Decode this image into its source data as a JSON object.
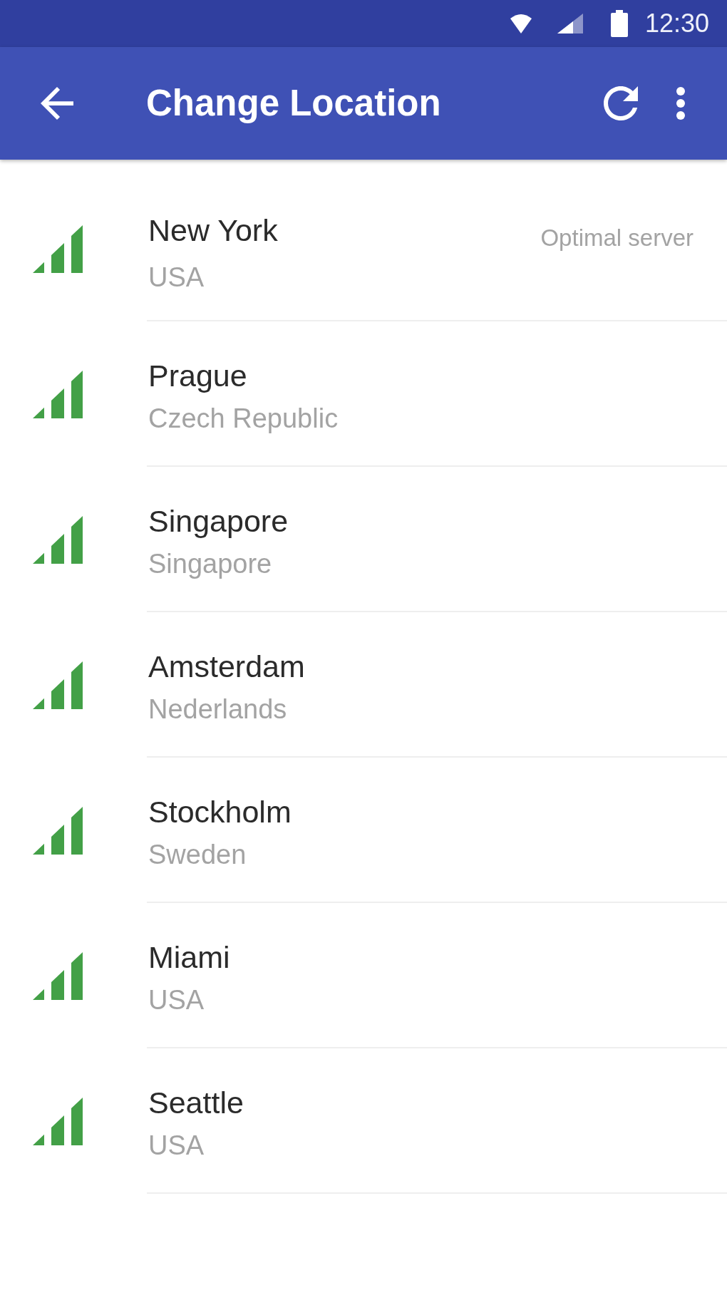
{
  "status_bar": {
    "time": "12:30"
  },
  "app_bar": {
    "title": "Change Location"
  },
  "locations": [
    {
      "city": "New York",
      "country": "USA",
      "note": "Optimal server"
    },
    {
      "city": "Prague",
      "country": "Czech Republic"
    },
    {
      "city": "Singapore",
      "country": "Singapore"
    },
    {
      "city": "Amsterdam",
      "country": "Nederlands"
    },
    {
      "city": "Stockholm",
      "country": "Sweden"
    },
    {
      "city": "Miami",
      "country": "USA"
    },
    {
      "city": "Seattle",
      "country": "USA"
    }
  ]
}
